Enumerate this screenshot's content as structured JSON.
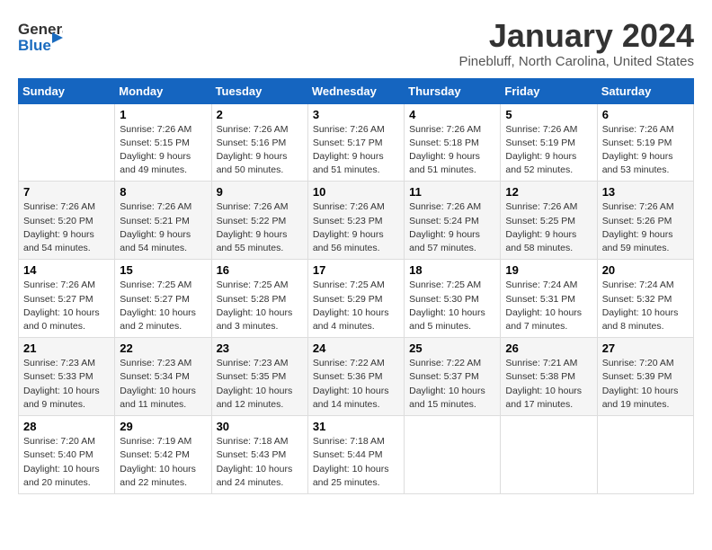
{
  "header": {
    "logo_general": "General",
    "logo_blue": "Blue",
    "month_title": "January 2024",
    "location": "Pinebluff, North Carolina, United States"
  },
  "days_of_week": [
    "Sunday",
    "Monday",
    "Tuesday",
    "Wednesday",
    "Thursday",
    "Friday",
    "Saturday"
  ],
  "weeks": [
    [
      {
        "date": "",
        "info": ""
      },
      {
        "date": "1",
        "info": "Sunrise: 7:26 AM\nSunset: 5:15 PM\nDaylight: 9 hours\nand 49 minutes."
      },
      {
        "date": "2",
        "info": "Sunrise: 7:26 AM\nSunset: 5:16 PM\nDaylight: 9 hours\nand 50 minutes."
      },
      {
        "date": "3",
        "info": "Sunrise: 7:26 AM\nSunset: 5:17 PM\nDaylight: 9 hours\nand 51 minutes."
      },
      {
        "date": "4",
        "info": "Sunrise: 7:26 AM\nSunset: 5:18 PM\nDaylight: 9 hours\nand 51 minutes."
      },
      {
        "date": "5",
        "info": "Sunrise: 7:26 AM\nSunset: 5:19 PM\nDaylight: 9 hours\nand 52 minutes."
      },
      {
        "date": "6",
        "info": "Sunrise: 7:26 AM\nSunset: 5:19 PM\nDaylight: 9 hours\nand 53 minutes."
      }
    ],
    [
      {
        "date": "7",
        "info": "Sunrise: 7:26 AM\nSunset: 5:20 PM\nDaylight: 9 hours\nand 54 minutes."
      },
      {
        "date": "8",
        "info": "Sunrise: 7:26 AM\nSunset: 5:21 PM\nDaylight: 9 hours\nand 54 minutes."
      },
      {
        "date": "9",
        "info": "Sunrise: 7:26 AM\nSunset: 5:22 PM\nDaylight: 9 hours\nand 55 minutes."
      },
      {
        "date": "10",
        "info": "Sunrise: 7:26 AM\nSunset: 5:23 PM\nDaylight: 9 hours\nand 56 minutes."
      },
      {
        "date": "11",
        "info": "Sunrise: 7:26 AM\nSunset: 5:24 PM\nDaylight: 9 hours\nand 57 minutes."
      },
      {
        "date": "12",
        "info": "Sunrise: 7:26 AM\nSunset: 5:25 PM\nDaylight: 9 hours\nand 58 minutes."
      },
      {
        "date": "13",
        "info": "Sunrise: 7:26 AM\nSunset: 5:26 PM\nDaylight: 9 hours\nand 59 minutes."
      }
    ],
    [
      {
        "date": "14",
        "info": "Sunrise: 7:26 AM\nSunset: 5:27 PM\nDaylight: 10 hours\nand 0 minutes."
      },
      {
        "date": "15",
        "info": "Sunrise: 7:25 AM\nSunset: 5:27 PM\nDaylight: 10 hours\nand 2 minutes."
      },
      {
        "date": "16",
        "info": "Sunrise: 7:25 AM\nSunset: 5:28 PM\nDaylight: 10 hours\nand 3 minutes."
      },
      {
        "date": "17",
        "info": "Sunrise: 7:25 AM\nSunset: 5:29 PM\nDaylight: 10 hours\nand 4 minutes."
      },
      {
        "date": "18",
        "info": "Sunrise: 7:25 AM\nSunset: 5:30 PM\nDaylight: 10 hours\nand 5 minutes."
      },
      {
        "date": "19",
        "info": "Sunrise: 7:24 AM\nSunset: 5:31 PM\nDaylight: 10 hours\nand 7 minutes."
      },
      {
        "date": "20",
        "info": "Sunrise: 7:24 AM\nSunset: 5:32 PM\nDaylight: 10 hours\nand 8 minutes."
      }
    ],
    [
      {
        "date": "21",
        "info": "Sunrise: 7:23 AM\nSunset: 5:33 PM\nDaylight: 10 hours\nand 9 minutes."
      },
      {
        "date": "22",
        "info": "Sunrise: 7:23 AM\nSunset: 5:34 PM\nDaylight: 10 hours\nand 11 minutes."
      },
      {
        "date": "23",
        "info": "Sunrise: 7:23 AM\nSunset: 5:35 PM\nDaylight: 10 hours\nand 12 minutes."
      },
      {
        "date": "24",
        "info": "Sunrise: 7:22 AM\nSunset: 5:36 PM\nDaylight: 10 hours\nand 14 minutes."
      },
      {
        "date": "25",
        "info": "Sunrise: 7:22 AM\nSunset: 5:37 PM\nDaylight: 10 hours\nand 15 minutes."
      },
      {
        "date": "26",
        "info": "Sunrise: 7:21 AM\nSunset: 5:38 PM\nDaylight: 10 hours\nand 17 minutes."
      },
      {
        "date": "27",
        "info": "Sunrise: 7:20 AM\nSunset: 5:39 PM\nDaylight: 10 hours\nand 19 minutes."
      }
    ],
    [
      {
        "date": "28",
        "info": "Sunrise: 7:20 AM\nSunset: 5:40 PM\nDaylight: 10 hours\nand 20 minutes."
      },
      {
        "date": "29",
        "info": "Sunrise: 7:19 AM\nSunset: 5:42 PM\nDaylight: 10 hours\nand 22 minutes."
      },
      {
        "date": "30",
        "info": "Sunrise: 7:18 AM\nSunset: 5:43 PM\nDaylight: 10 hours\nand 24 minutes."
      },
      {
        "date": "31",
        "info": "Sunrise: 7:18 AM\nSunset: 5:44 PM\nDaylight: 10 hours\nand 25 minutes."
      },
      {
        "date": "",
        "info": ""
      },
      {
        "date": "",
        "info": ""
      },
      {
        "date": "",
        "info": ""
      }
    ]
  ]
}
